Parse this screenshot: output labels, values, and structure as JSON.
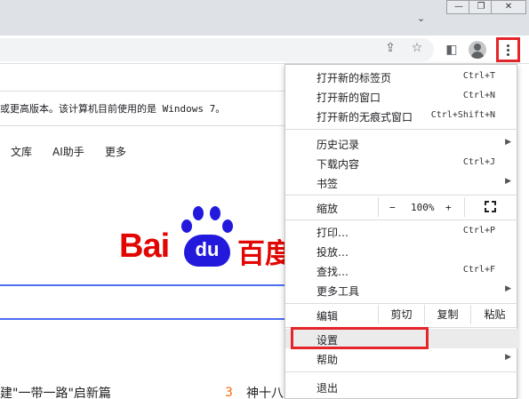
{
  "window": {
    "minimize_glyph": "—",
    "restore_glyph": "❐",
    "close_glyph": "✕",
    "tabs_chevron_glyph": "⌄"
  },
  "toolbar": {
    "share_glyph": "⇪",
    "star_glyph": "☆",
    "sidepanel_glyph": "◧"
  },
  "infobar": {
    "text": "或更高版本。该计算机目前使用的是 Windows 7。"
  },
  "page_nav": {
    "items": [
      "文库",
      "AI助手",
      "更多"
    ]
  },
  "logo": {
    "latin": "Bai",
    "paw_text": "du",
    "chinese": "百度"
  },
  "hot_news": {
    "item_left": "建\"一带一路\"启新篇",
    "rank_right": "3",
    "item_right": "神十八"
  },
  "menu": {
    "new_tab": {
      "label": "打开新的标签页",
      "shortcut": "Ctrl+T"
    },
    "new_window": {
      "label": "打开新的窗口",
      "shortcut": "Ctrl+N"
    },
    "new_incognito": {
      "label": "打开新的无痕式窗口",
      "shortcut": "Ctrl+Shift+N"
    },
    "history": {
      "label": "历史记录",
      "arrow": "▶"
    },
    "downloads": {
      "label": "下载内容",
      "shortcut": "Ctrl+J"
    },
    "bookmarks": {
      "label": "书签",
      "arrow": "▶"
    },
    "zoom": {
      "label": "缩放",
      "minus": "−",
      "value": "100%",
      "plus": "+"
    },
    "print": {
      "label": "打印…",
      "shortcut": "Ctrl+P"
    },
    "cast": {
      "label": "投放…"
    },
    "find": {
      "label": "查找…",
      "shortcut": "Ctrl+F"
    },
    "more_tools": {
      "label": "更多工具",
      "arrow": "▶"
    },
    "edit": {
      "label": "编辑",
      "cut": "剪切",
      "copy": "复制",
      "paste": "粘贴"
    },
    "settings": {
      "label": "设置"
    },
    "help": {
      "label": "帮助",
      "arrow": "▶"
    },
    "exit": {
      "label": "退出"
    }
  },
  "colors": {
    "highlight_red": "#e5252a",
    "baidu_red": "#e10602",
    "baidu_blue": "#2319dc",
    "search_border": "#4e6ef2"
  }
}
